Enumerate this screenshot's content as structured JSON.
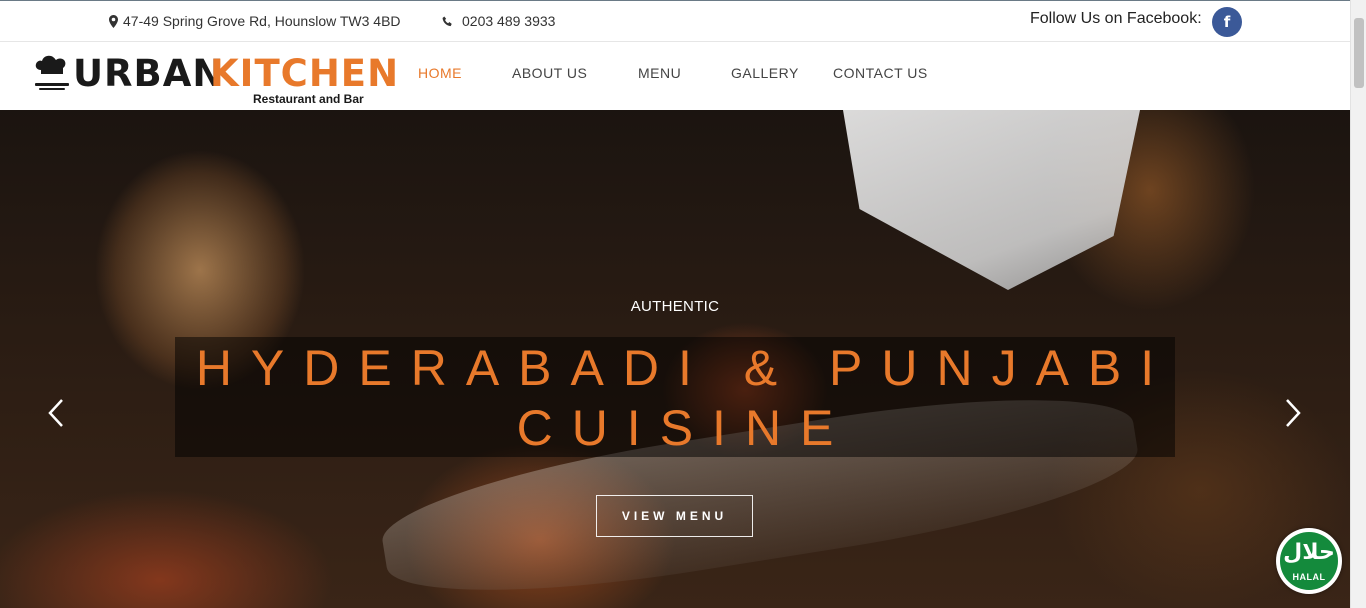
{
  "topbar": {
    "address": "47-49 Spring Grove Rd, Hounslow TW3 4BD",
    "address_icon": "map-marker-icon",
    "phone": "0203 489 3933",
    "phone_icon": "phone-icon",
    "follow_text": "Follow Us on Facebook:",
    "facebook_icon_glyph": "f"
  },
  "logo": {
    "word1": "URBAN",
    "word2": "KITCHEN",
    "tagline": "Restaurant and Bar"
  },
  "nav": {
    "items": [
      {
        "label": "HOME",
        "active": true
      },
      {
        "label": "ABOUT US",
        "active": false
      },
      {
        "label": "MENU",
        "active": false
      },
      {
        "label": "GALLERY",
        "active": false
      },
      {
        "label": "CONTACT US",
        "active": false
      }
    ]
  },
  "hero": {
    "eyebrow": "AUTHENTIC",
    "title_line1": "HYDERABADI & PUNJABI",
    "title_line2": "CUISINE",
    "button_label": "VIEW MENU"
  },
  "halal": {
    "arabic": "حلال",
    "label": "HALAL"
  },
  "colors": {
    "accent": "#e8792b",
    "facebook": "#3b5998",
    "halal_green": "#148a3c"
  }
}
